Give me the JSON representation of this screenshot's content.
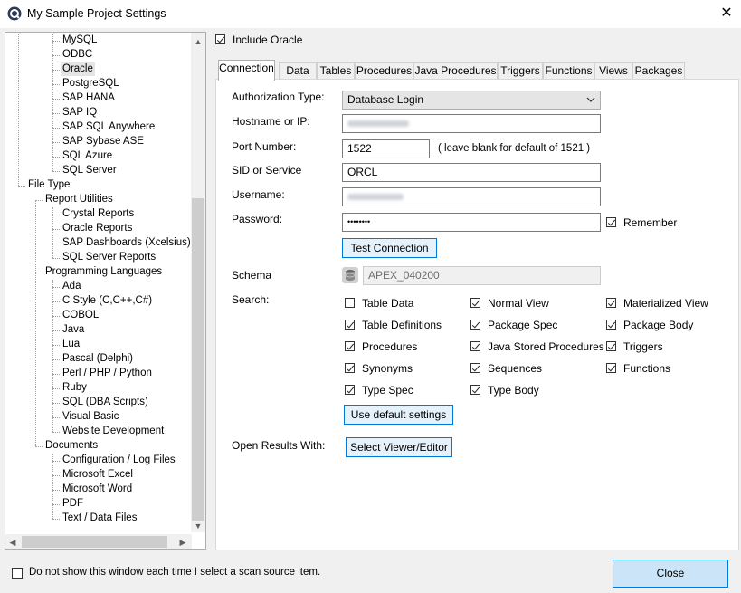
{
  "window": {
    "title": "My Sample Project Settings",
    "close_glyph": "✕"
  },
  "tree": {
    "items": [
      {
        "label": "MySQL",
        "level": 2
      },
      {
        "label": "ODBC",
        "level": 2
      },
      {
        "label": "Oracle",
        "level": 2,
        "selected": true
      },
      {
        "label": "PostgreSQL",
        "level": 2
      },
      {
        "label": "SAP HANA",
        "level": 2
      },
      {
        "label": "SAP IQ",
        "level": 2
      },
      {
        "label": "SAP SQL Anywhere",
        "level": 2
      },
      {
        "label": "SAP Sybase ASE",
        "level": 2
      },
      {
        "label": "SQL Azure",
        "level": 2
      },
      {
        "label": "SQL Server",
        "level": 2
      },
      {
        "label": "File Type",
        "level": 0
      },
      {
        "label": "Report Utilities",
        "level": 1
      },
      {
        "label": "Crystal Reports",
        "level": 2
      },
      {
        "label": "Oracle Reports",
        "level": 2
      },
      {
        "label": "SAP Dashboards (Xcelsius)",
        "level": 2
      },
      {
        "label": "SQL Server Reports",
        "level": 2
      },
      {
        "label": "Programming Languages",
        "level": 1
      },
      {
        "label": "Ada",
        "level": 2
      },
      {
        "label": "C Style (C,C++,C#)",
        "level": 2
      },
      {
        "label": "COBOL",
        "level": 2
      },
      {
        "label": "Java",
        "level": 2
      },
      {
        "label": "Lua",
        "level": 2
      },
      {
        "label": "Pascal (Delphi)",
        "level": 2
      },
      {
        "label": "Perl / PHP / Python",
        "level": 2
      },
      {
        "label": "Ruby",
        "level": 2
      },
      {
        "label": "SQL (DBA Scripts)",
        "level": 2
      },
      {
        "label": "Visual Basic",
        "level": 2
      },
      {
        "label": "Website Development",
        "level": 2
      },
      {
        "label": "Documents",
        "level": 1
      },
      {
        "label": "Configuration / Log Files",
        "level": 2
      },
      {
        "label": "Microsoft Excel",
        "level": 2
      },
      {
        "label": "Microsoft Word",
        "level": 2
      },
      {
        "label": "PDF",
        "level": 2
      },
      {
        "label": "Text / Data Files",
        "level": 2
      }
    ],
    "scroll_up": "▲",
    "scroll_down": "▼",
    "scroll_left": "◀",
    "scroll_right": "▶"
  },
  "include": {
    "label": "Include Oracle",
    "checked": true
  },
  "tabs": [
    "Connection",
    "Data",
    "Tables",
    "Procedures",
    "Java Procedures",
    "Triggers",
    "Functions",
    "Views",
    "Packages"
  ],
  "active_tab": 0,
  "form": {
    "auth_label": "Authorization Type:",
    "auth_value": "Database Login",
    "host_label": "Hostname or IP:",
    "port_label": "Port Number:",
    "port_value": "1522",
    "port_hint": "( leave blank for default of 1521 )",
    "sid_label": "SID or Service",
    "sid_value": "ORCL",
    "user_label": "Username:",
    "pass_label": "Password:",
    "pass_value": "••••••••",
    "remember_label": "Remember",
    "remember_checked": true,
    "test_button": "Test Connection",
    "schema_label": "Schema",
    "schema_value": "APEX_040200",
    "search_label": "Search:",
    "default_button": "Use default settings",
    "open_label": "Open Results With:",
    "viewer_button": "Select Viewer/Editor"
  },
  "search_options": [
    {
      "label": "Table Data",
      "checked": false
    },
    {
      "label": "Normal View",
      "checked": true
    },
    {
      "label": "Materialized View",
      "checked": true
    },
    {
      "label": "Table Definitions",
      "checked": true
    },
    {
      "label": "Package Spec",
      "checked": true
    },
    {
      "label": "Package Body",
      "checked": true
    },
    {
      "label": "Procedures",
      "checked": true
    },
    {
      "label": "Java Stored Procedures",
      "checked": true
    },
    {
      "label": "Triggers",
      "checked": true
    },
    {
      "label": "Synonyms",
      "checked": true
    },
    {
      "label": "Sequences",
      "checked": true
    },
    {
      "label": "Functions",
      "checked": true
    },
    {
      "label": "Type Spec",
      "checked": true
    },
    {
      "label": "Type Body",
      "checked": true
    }
  ],
  "footer": {
    "dont_show_label": "Do not show this window each time I select a scan source item.",
    "dont_show_checked": false,
    "close_button": "Close"
  },
  "colors": {
    "accent": "#0078d7",
    "button_bg": "#e5f1fb",
    "close_bg": "#cce4f7"
  }
}
